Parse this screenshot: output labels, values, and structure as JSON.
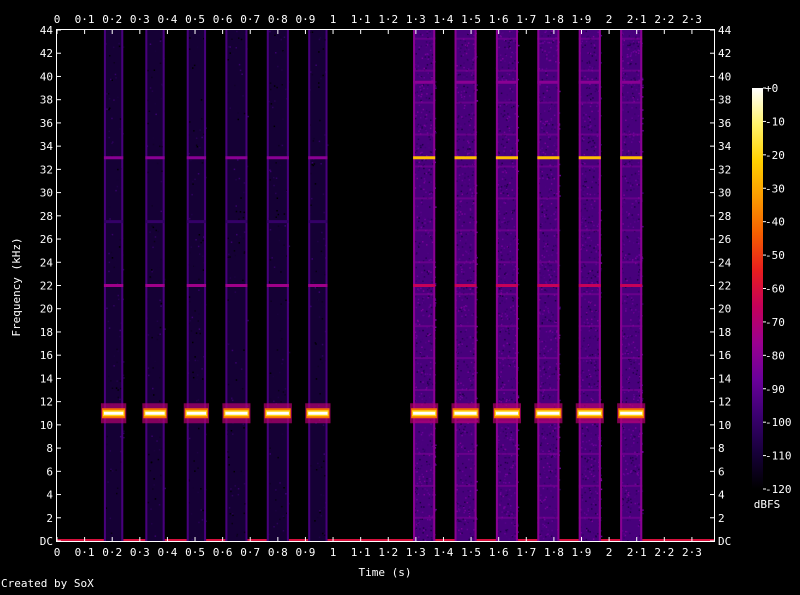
{
  "chart_data": {
    "type": "heatmap",
    "title": "",
    "xlabel": "Time (s)",
    "ylabel": "Frequency (kHz)",
    "xlim": [
      0,
      2.38
    ],
    "ylim": [
      0,
      44
    ],
    "x_ticks": [
      0,
      0.1,
      0.2,
      0.3,
      0.4,
      0.5,
      0.6,
      0.7,
      0.8,
      0.9,
      1,
      1.1,
      1.2,
      1.3,
      1.4,
      1.5,
      1.6,
      1.7,
      1.8,
      1.9,
      2,
      2.1,
      2.2,
      2.3
    ],
    "x_tick_labels": [
      "0",
      "0·1",
      "0·2",
      "0·3",
      "0·4",
      "0·5",
      "0·6",
      "0·7",
      "0·8",
      "0·9",
      "1",
      "1·1",
      "1·2",
      "1·3",
      "1·4",
      "1·5",
      "1·6",
      "1·7",
      "1·8",
      "1·9",
      "2",
      "2·1",
      "2·2",
      "2·3"
    ],
    "y_ticks": [
      0,
      2,
      4,
      6,
      8,
      10,
      12,
      14,
      16,
      18,
      20,
      22,
      24,
      26,
      28,
      30,
      32,
      34,
      36,
      38,
      40,
      42,
      44
    ],
    "y_tick_labels": [
      "DC",
      "2",
      "4",
      "6",
      "8",
      "10",
      "12",
      "14",
      "16",
      "18",
      "20",
      "22",
      "24",
      "26",
      "28",
      "30",
      "32",
      "34",
      "36",
      "38",
      "40",
      "42",
      "44"
    ],
    "colorbar": {
      "label": "dBFS",
      "range": [
        -120,
        0
      ],
      "ticks": [
        0,
        -10,
        -20,
        -30,
        -40,
        -50,
        -60,
        -70,
        -80,
        -90,
        -100,
        -110,
        -120
      ],
      "tick_labels": [
        "+0",
        "-10",
        "-20",
        "-30",
        "-40",
        "-50",
        "-60",
        "-70",
        "-80",
        "-90",
        "-100",
        "-110",
        "-120"
      ]
    },
    "background_db": -120,
    "tone_bursts": [
      {
        "start": 0.17,
        "end": 0.24,
        "noise_floor_db": -110,
        "harmonics": [
          {
            "freq": 11.0,
            "db": 0
          },
          {
            "freq": 22.0,
            "db": -75
          },
          {
            "freq": 33.0,
            "db": -80
          },
          {
            "freq": 27.5,
            "db": -100
          }
        ]
      },
      {
        "start": 0.32,
        "end": 0.39,
        "noise_floor_db": -110,
        "harmonics": [
          {
            "freq": 11.0,
            "db": 0
          },
          {
            "freq": 22.0,
            "db": -75
          },
          {
            "freq": 33.0,
            "db": -80
          },
          {
            "freq": 27.5,
            "db": -100
          }
        ]
      },
      {
        "start": 0.47,
        "end": 0.54,
        "noise_floor_db": -110,
        "harmonics": [
          {
            "freq": 11.0,
            "db": 0
          },
          {
            "freq": 22.0,
            "db": -75
          },
          {
            "freq": 33.0,
            "db": -80
          },
          {
            "freq": 27.5,
            "db": -100
          }
        ]
      },
      {
        "start": 0.61,
        "end": 0.69,
        "noise_floor_db": -110,
        "harmonics": [
          {
            "freq": 11.0,
            "db": 0
          },
          {
            "freq": 22.0,
            "db": -75
          },
          {
            "freq": 33.0,
            "db": -80
          },
          {
            "freq": 27.5,
            "db": -100
          }
        ]
      },
      {
        "start": 0.76,
        "end": 0.84,
        "noise_floor_db": -110,
        "harmonics": [
          {
            "freq": 11.0,
            "db": 0
          },
          {
            "freq": 22.0,
            "db": -75
          },
          {
            "freq": 33.0,
            "db": -80
          },
          {
            "freq": 27.5,
            "db": -100
          }
        ]
      },
      {
        "start": 0.91,
        "end": 0.98,
        "noise_floor_db": -110,
        "harmonics": [
          {
            "freq": 11.0,
            "db": 0
          },
          {
            "freq": 22.0,
            "db": -75
          },
          {
            "freq": 33.0,
            "db": -80
          },
          {
            "freq": 27.5,
            "db": -100
          }
        ]
      },
      {
        "start": 1.29,
        "end": 1.37,
        "noise_floor_db": -95,
        "harmonics": [
          {
            "freq": 11.0,
            "db": 0
          },
          {
            "freq": 33.0,
            "db": -25
          },
          {
            "freq": 22.0,
            "db": -65
          },
          {
            "freq": 39.5,
            "db": -80
          }
        ]
      },
      {
        "start": 1.44,
        "end": 1.52,
        "noise_floor_db": -95,
        "harmonics": [
          {
            "freq": 11.0,
            "db": 0
          },
          {
            "freq": 33.0,
            "db": -25
          },
          {
            "freq": 22.0,
            "db": -65
          },
          {
            "freq": 39.5,
            "db": -80
          }
        ]
      },
      {
        "start": 1.59,
        "end": 1.67,
        "noise_floor_db": -95,
        "harmonics": [
          {
            "freq": 11.0,
            "db": 0
          },
          {
            "freq": 33.0,
            "db": -25
          },
          {
            "freq": 22.0,
            "db": -65
          },
          {
            "freq": 39.5,
            "db": -80
          }
        ]
      },
      {
        "start": 1.74,
        "end": 1.82,
        "noise_floor_db": -95,
        "harmonics": [
          {
            "freq": 11.0,
            "db": 0
          },
          {
            "freq": 33.0,
            "db": -25
          },
          {
            "freq": 22.0,
            "db": -65
          },
          {
            "freq": 39.5,
            "db": -80
          }
        ]
      },
      {
        "start": 1.89,
        "end": 1.97,
        "noise_floor_db": -95,
        "harmonics": [
          {
            "freq": 11.0,
            "db": 0
          },
          {
            "freq": 33.0,
            "db": -25
          },
          {
            "freq": 22.0,
            "db": -65
          },
          {
            "freq": 39.5,
            "db": -80
          }
        ]
      },
      {
        "start": 2.04,
        "end": 2.12,
        "noise_floor_db": -95,
        "harmonics": [
          {
            "freq": 11.0,
            "db": 0
          },
          {
            "freq": 33.0,
            "db": -25
          },
          {
            "freq": 22.0,
            "db": -65
          },
          {
            "freq": 39.5,
            "db": -80
          }
        ]
      }
    ],
    "dc_band_db": -60
  },
  "footer": {
    "credit": "Created by SoX"
  },
  "colors": {
    "background": "#000000",
    "axis": "#ffffff",
    "colormap": [
      "#000000",
      "#17003a",
      "#3a0070",
      "#6a009a",
      "#9a0090",
      "#c5005a",
      "#e81e1e",
      "#f55e00",
      "#fb9a00",
      "#ffd000",
      "#fff36a",
      "#ffffff"
    ]
  }
}
